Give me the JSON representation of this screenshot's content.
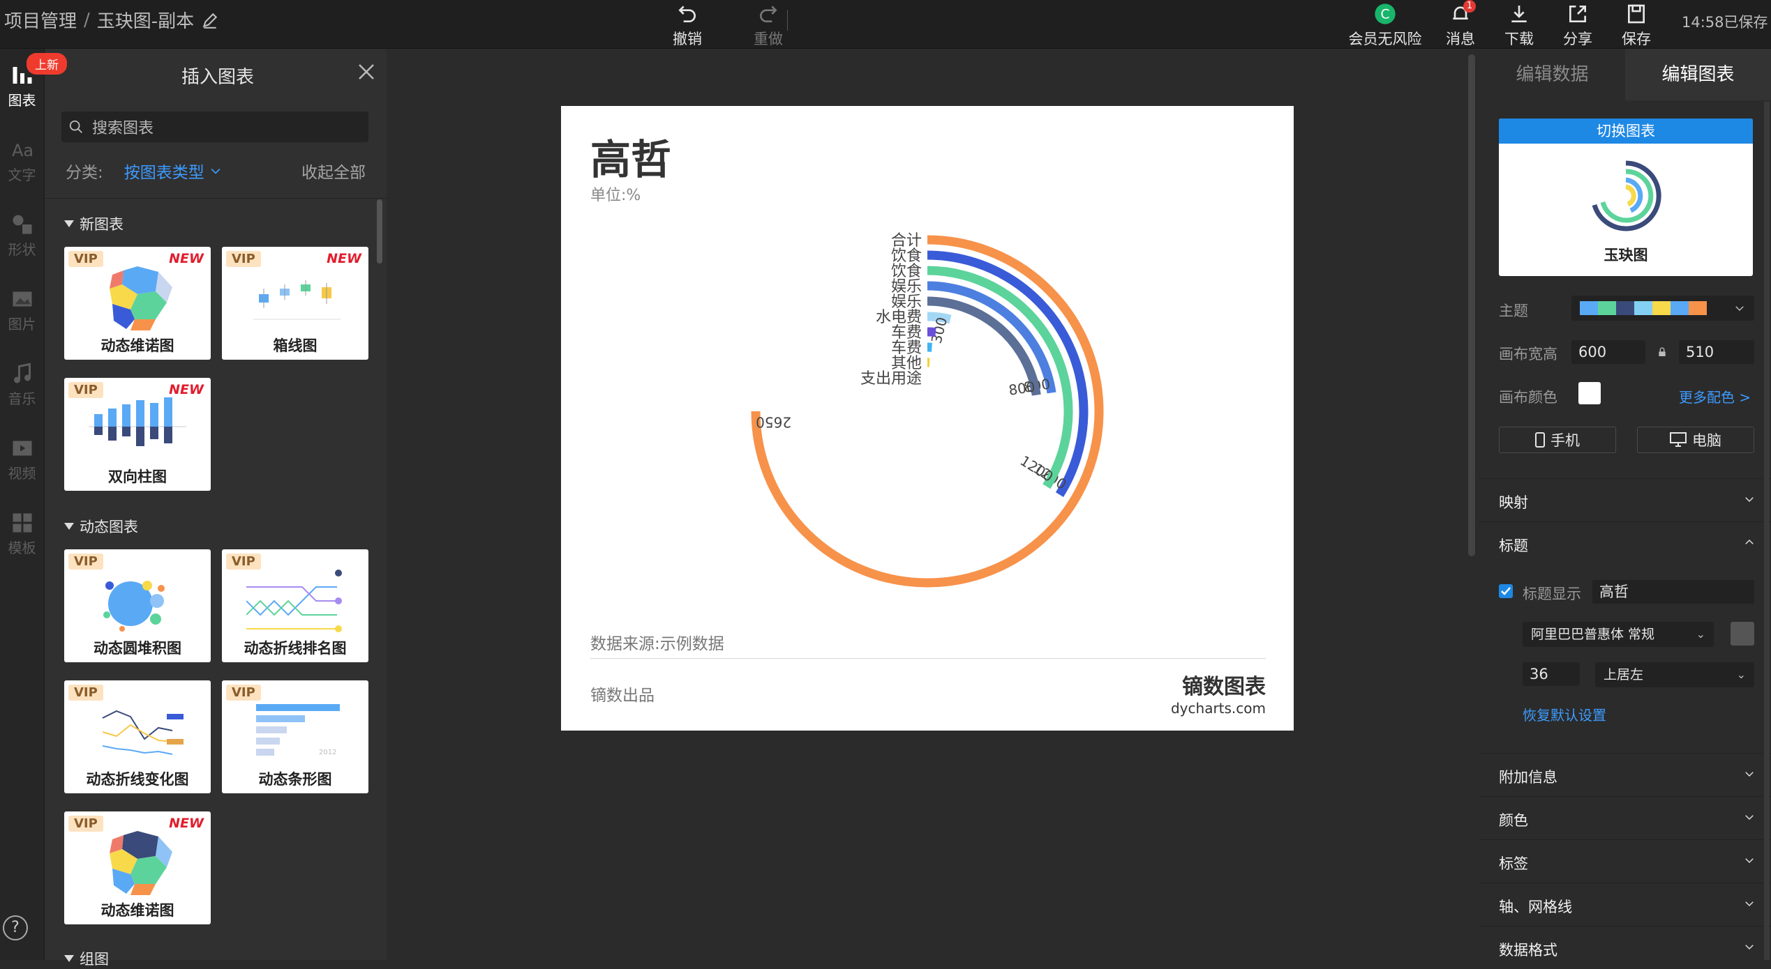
{
  "breadcrumb": {
    "root": "项目管理",
    "separator": "/",
    "current": "玉玦图-副本"
  },
  "toolbar": {
    "undo": "撤销",
    "redo": "重做",
    "member": "会员无风险",
    "messages": "消息",
    "message_count": "1",
    "download": "下载",
    "share": "分享",
    "save": "保存",
    "saved_status": "14:58已保存"
  },
  "rail": [
    {
      "label": "图表",
      "icon": "bar-chart-icon"
    },
    {
      "label": "文字",
      "icon": "text-icon"
    },
    {
      "label": "形状",
      "icon": "shapes-icon"
    },
    {
      "label": "图片",
      "icon": "image-icon"
    },
    {
      "label": "音乐",
      "icon": "music-icon"
    },
    {
      "label": "视频",
      "icon": "video-icon"
    },
    {
      "label": "模板",
      "icon": "template-icon"
    }
  ],
  "rail_help": "?",
  "insert_panel": {
    "new_tag": "上新",
    "title": "插入图表",
    "search_placeholder": "搜索图表",
    "category_label": "分类:",
    "category_value": "按图表类型",
    "collapse_all": "收起全部",
    "sections": [
      {
        "title": "新图表"
      },
      {
        "title": "动态图表"
      },
      {
        "title": "组图"
      }
    ],
    "badges": {
      "vip": "VIP",
      "new": "NEW"
    },
    "cards": [
      {
        "name": "动态维诺图",
        "vip": true,
        "new": true
      },
      {
        "name": "箱线图",
        "vip": true,
        "new": true
      },
      {
        "name": "双向柱图",
        "vip": true,
        "new": true
      },
      {
        "name": "动态圆堆积图",
        "vip": true,
        "new": false
      },
      {
        "name": "动态折线排名图",
        "vip": true,
        "new": false
      },
      {
        "name": "动态折线变化图",
        "vip": true,
        "new": false
      },
      {
        "name": "动态条形图",
        "vip": true,
        "new": false
      },
      {
        "name": "动态维诺图",
        "vip": true,
        "new": true
      }
    ]
  },
  "canvas": {
    "title": "高哲",
    "unit": "单位:%",
    "source": "数据来源:示例数据",
    "producer": "镝数出品",
    "brand_cn": "镝数图表",
    "brand_url": "dycharts.com"
  },
  "chart_data": {
    "type": "radial-bar",
    "categories": [
      "合计",
      "饮食",
      "饮食",
      "娱乐",
      "娱乐",
      "水电费",
      "车费",
      "车费",
      "其他",
      "支出用途"
    ],
    "values": [
      2650,
      1200,
      1200,
      800,
      800,
      300,
      null,
      null,
      null,
      null
    ],
    "data_labels": [
      "2650",
      "1200",
      "1200",
      "800",
      "800",
      "300"
    ],
    "colors": [
      "#f7924a",
      "#3a5bd8",
      "#5cd39b",
      "#4d7fe0",
      "#5b6f97",
      "#a3d7f5",
      "#6a4fd8",
      "#41b3f0",
      "#f5d033"
    ]
  },
  "right_panel": {
    "tabs": [
      "编辑数据",
      "编辑图表"
    ],
    "switch_chart": "切换图表",
    "current_chart": "玉玦图",
    "theme_label": "主题",
    "theme_colors": [
      "#5aa9f5",
      "#5cd39b",
      "#3a4a7a",
      "#84d0f5",
      "#f7d94a",
      "#5aa9f5",
      "#f7924a"
    ],
    "canvas_size_label": "画布宽高",
    "width": "600",
    "height": "510",
    "canvas_color_label": "画布颜色",
    "canvas_color": "#ffffff",
    "more_colors": "更多配色 >",
    "phone": "手机",
    "pc": "电脑",
    "sections": {
      "mapping": "映射",
      "title": "标题",
      "extra": "附加信息",
      "color": "颜色",
      "label": "标签",
      "axis": "轴、网格线",
      "format": "数据格式"
    },
    "title_show_label": "标题显示",
    "title_value": "高哲",
    "font": "阿里巴巴普惠体 常规",
    "font_size": "36",
    "position": "上居左",
    "reset": "恢复默认设置"
  }
}
